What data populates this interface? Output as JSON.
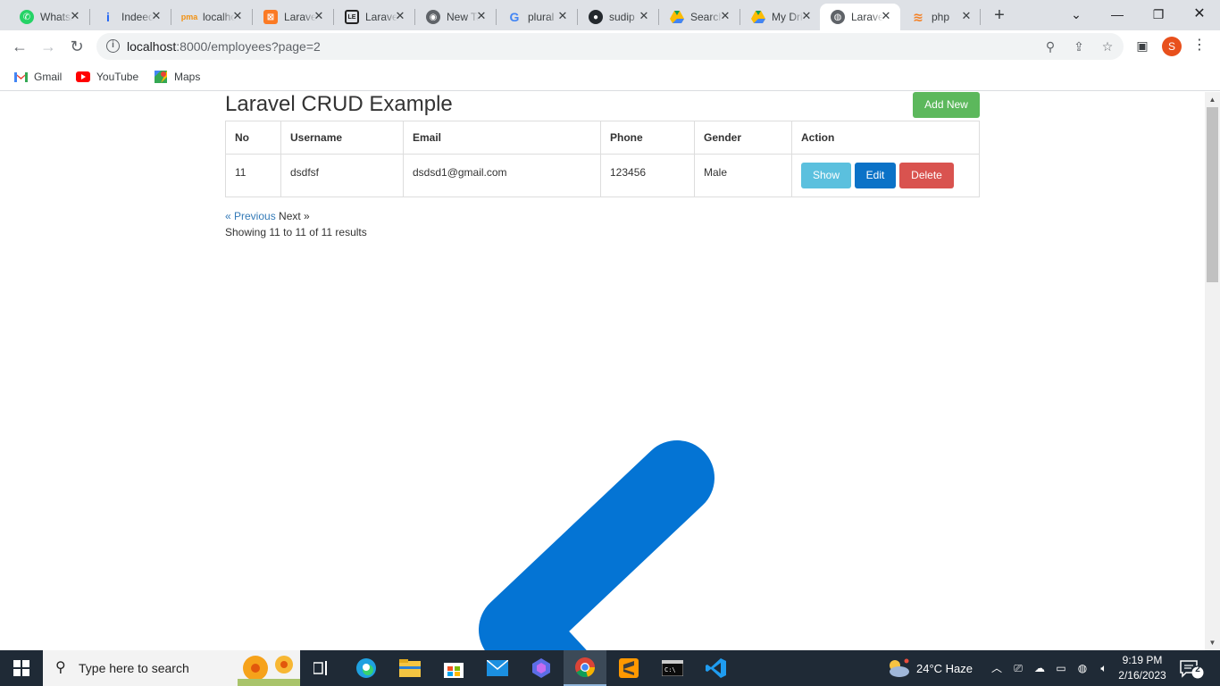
{
  "browser": {
    "tabs": [
      {
        "title": "WhatsApp",
        "icon": "whatsapp-icon",
        "color": "#25d366"
      },
      {
        "title": "Indeed",
        "icon": "indeed-icon",
        "color": "#2164f3"
      },
      {
        "title": "localhost",
        "icon": "phpmyadmin-icon",
        "color": "#f29111"
      },
      {
        "title": "Laravel",
        "icon": "xampp-icon",
        "color": "#fb7a24"
      },
      {
        "title": "Laravel",
        "icon": "laravel-icon",
        "color": "#222222"
      },
      {
        "title": "New Tab",
        "icon": "chrome-icon",
        "color": "#5f6368"
      },
      {
        "title": "plural",
        "icon": "google-icon",
        "color": "#4285f4"
      },
      {
        "title": "sudip",
        "icon": "github-icon",
        "color": "#24292e"
      },
      {
        "title": "Search",
        "icon": "drive-icon",
        "color": "#0f9d58"
      },
      {
        "title": "My Drive",
        "icon": "drive-icon",
        "color": "#0f9d58"
      },
      {
        "title": "Laravel",
        "icon": "globe-icon",
        "color": "#5f6368",
        "active": true
      },
      {
        "title": "php",
        "icon": "stackoverflow-icon",
        "color": "#f48024"
      }
    ],
    "url_host": "localhost",
    "url_path": ":8000/employees?page=2",
    "profile_initial": "S",
    "bookmarks": [
      {
        "label": "Gmail",
        "icon": "gmail-icon"
      },
      {
        "label": "YouTube",
        "icon": "youtube-icon"
      },
      {
        "label": "Maps",
        "icon": "maps-icon"
      }
    ]
  },
  "page": {
    "title": "Laravel CRUD Example",
    "add_button": "Add New",
    "table": {
      "headers": [
        "No",
        "Username",
        "Email",
        "Phone",
        "Gender",
        "Action"
      ],
      "rows": [
        {
          "no": "11",
          "username": "dsdfsf",
          "email": "dsdsd1@gmail.com",
          "phone": "123456",
          "gender": "Male"
        }
      ],
      "actions": {
        "show": "Show",
        "edit": "Edit",
        "delete": "Delete"
      }
    },
    "pagination": {
      "previous": "« Previous",
      "next": "Next »"
    },
    "results_text": "Showing 11 to 11 of 11 results"
  },
  "taskbar": {
    "search_placeholder": "Type here to search",
    "weather": "24°C  Haze",
    "time": "9:19 PM",
    "date": "2/16/2023",
    "notification_count": "2"
  }
}
